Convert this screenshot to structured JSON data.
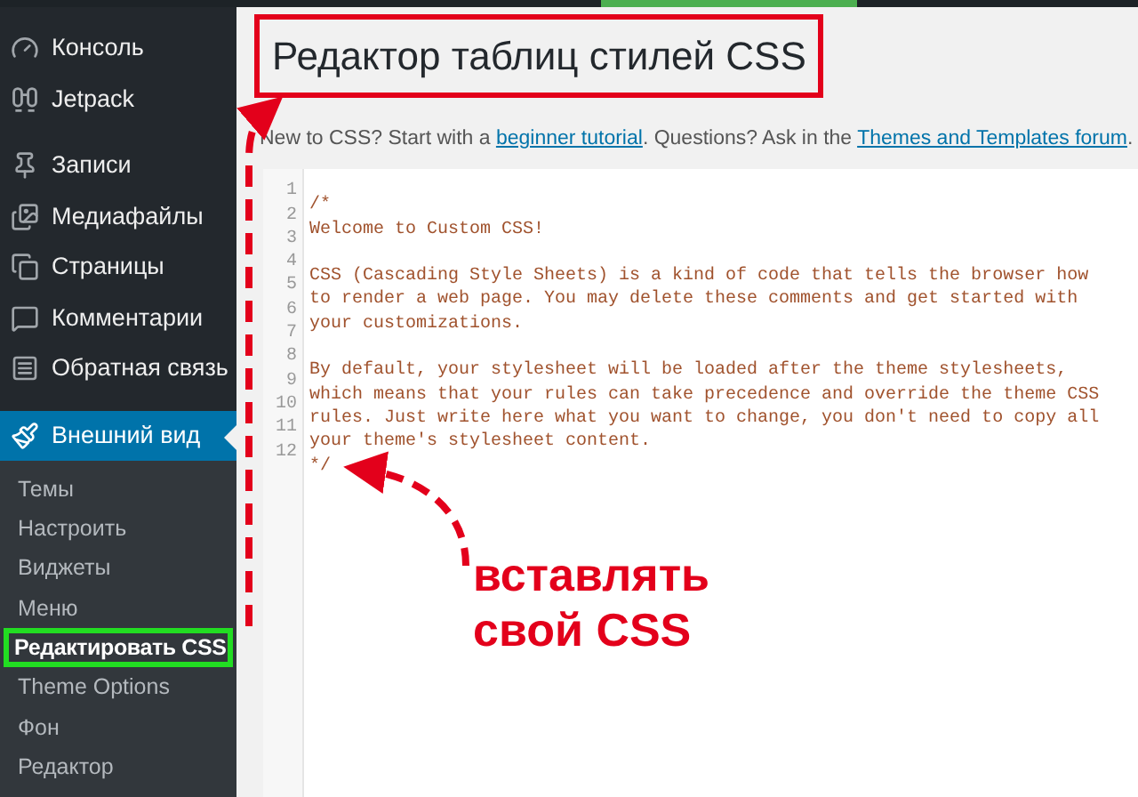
{
  "sidebar": {
    "menu": [
      {
        "label": "Консоль",
        "selected": false,
        "gap_after": false
      },
      {
        "label": "Jetpack",
        "selected": false,
        "gap_after": true
      },
      {
        "label": "Записи",
        "selected": false,
        "gap_after": false
      },
      {
        "label": "Медиафайлы",
        "selected": false,
        "gap_after": false
      },
      {
        "label": "Страницы",
        "selected": false,
        "gap_after": false
      },
      {
        "label": "Комментарии",
        "selected": false,
        "gap_after": false
      },
      {
        "label": "Обратная связь",
        "selected": false,
        "gap_after": true
      },
      {
        "label": "Внешний вид",
        "selected": true,
        "gap_after": false
      }
    ],
    "submenu": [
      {
        "label": "Темы",
        "selected": false
      },
      {
        "label": "Настроить",
        "selected": false
      },
      {
        "label": "Виджеты",
        "selected": false
      },
      {
        "label": "Меню",
        "selected": false
      },
      {
        "label": "Редактировать CSS",
        "selected": true
      },
      {
        "label": "Theme Options",
        "selected": false
      },
      {
        "label": "Фон",
        "selected": false
      },
      {
        "label": "Редактор",
        "selected": false
      }
    ]
  },
  "page": {
    "title": "Редактор таблиц стилей CSS",
    "intro": [
      {
        "kind": "text",
        "text": "New to CSS? Start with a "
      },
      {
        "kind": "link",
        "text": "beginner tutorial"
      },
      {
        "kind": "text",
        "text": ". Questions? Ask in the "
      },
      {
        "kind": "link",
        "text": "Themes and Templates forum"
      },
      {
        "kind": "text",
        "text": "."
      }
    ],
    "editor": {
      "lines": [
        {
          "number": "1",
          "text": "/*"
        },
        {
          "number": "2",
          "text": "Welcome to Custom CSS!"
        },
        {
          "number": "3"
        },
        {
          "number": "4",
          "text": "CSS (Cascading Style Sheets) is a kind of code that tells the browser how"
        },
        {
          "number": "5",
          "text": "to render a web page. You may delete these comments and get started with"
        },
        {
          "number": "6",
          "text": "your customizations."
        },
        {
          "number": "7"
        },
        {
          "number": "8",
          "text": "By default, your stylesheet will be loaded after the theme stylesheets,"
        },
        {
          "number": "9",
          "text": "which means that your rules can take precedence and override the theme CSS"
        },
        {
          "number": "10",
          "text": "rules. Just write here what you want to change, you don't need to copy all"
        },
        {
          "number": "11",
          "text": "your theme's stylesheet content."
        },
        {
          "number": "12",
          "text": "*/"
        }
      ]
    }
  },
  "annotation": {
    "callout": "вставлять свой CSS"
  }
}
